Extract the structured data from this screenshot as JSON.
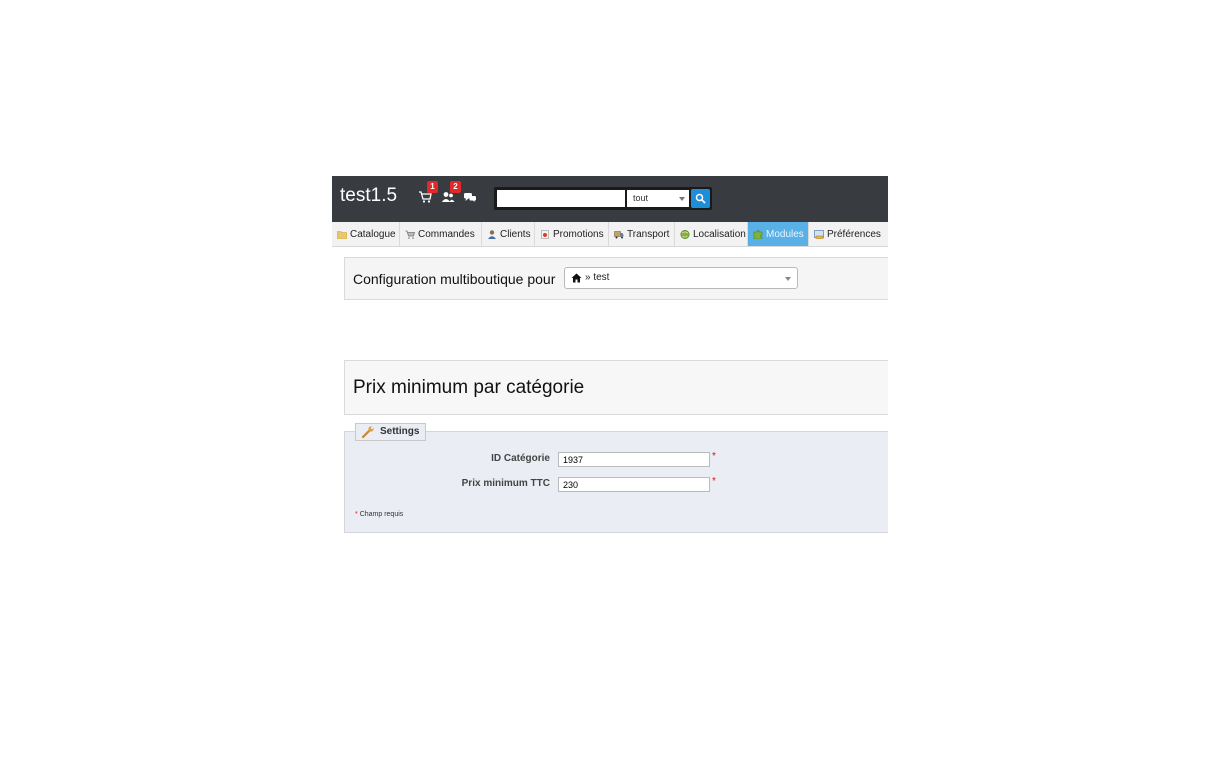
{
  "header": {
    "shop_name": "test1.5",
    "notifications": [
      {
        "icon": "cart-icon",
        "count": "1"
      },
      {
        "icon": "customers-icon",
        "count": "2"
      },
      {
        "icon": "messages-icon",
        "count": ""
      }
    ],
    "search": {
      "value": "",
      "scope": "tout",
      "button_icon": "search-icon"
    },
    "bar_color": "#383b40"
  },
  "nav": {
    "items": [
      {
        "label": "Catalogue",
        "icon": "folder-icon"
      },
      {
        "label": "Commandes",
        "icon": "cart-icon"
      },
      {
        "label": "Clients",
        "icon": "user-icon"
      },
      {
        "label": "Promotions",
        "icon": "tag-icon"
      },
      {
        "label": "Transport",
        "icon": "truck-icon"
      },
      {
        "label": "Localisation",
        "icon": "globe-icon"
      },
      {
        "label": "Modules",
        "icon": "puzzle-icon",
        "active": true
      },
      {
        "label": "Préférences",
        "icon": "settings-icon"
      }
    ],
    "active_color": "#59b0e6"
  },
  "multishop": {
    "label": "Configuration multiboutique pour",
    "selected": "» test"
  },
  "page": {
    "title": "Prix minimum par catégorie"
  },
  "form": {
    "legend": "Settings",
    "fields": [
      {
        "label": "ID Catégorie",
        "value": "1937",
        "required": "*"
      },
      {
        "label": "Prix minimum TTC",
        "value": "230",
        "required": "*"
      }
    ],
    "required_star": "*",
    "required_note": "Champ requis"
  }
}
